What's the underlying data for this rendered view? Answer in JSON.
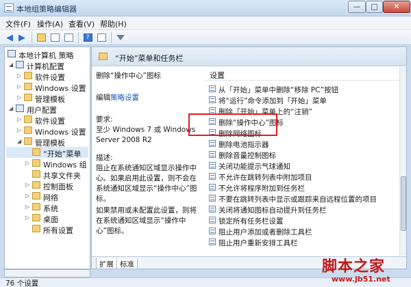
{
  "window": {
    "title": "本地组策略编辑器",
    "min_label": "—",
    "max_label": "□",
    "close_label": "✕"
  },
  "menu": {
    "items": [
      "文件(F)",
      "操作(A)",
      "查看(V)",
      "帮助(H)"
    ]
  },
  "tree": {
    "items": [
      {
        "label": "本地计算机 策略",
        "icon": "computer-icon"
      },
      {
        "label": "计算机配置",
        "icon": "computer-icon"
      },
      {
        "label": "软件设置",
        "icon": "folder-icon"
      },
      {
        "label": "Windows 设置",
        "icon": "folder-icon"
      },
      {
        "label": "管理模板",
        "icon": "folder-icon"
      },
      {
        "label": "用户配置",
        "icon": "user-icon"
      },
      {
        "label": "软件设置",
        "icon": "folder-icon"
      },
      {
        "label": "Windows 设置",
        "icon": "folder-icon"
      },
      {
        "label": "管理模板",
        "icon": "folder-icon"
      },
      {
        "label": "“开始”菜单",
        "icon": "folder-icon"
      },
      {
        "label": "Windows 组",
        "icon": "folder-icon"
      },
      {
        "label": "共享文件夹",
        "icon": "folder-icon"
      },
      {
        "label": "控制面板",
        "icon": "folder-icon"
      },
      {
        "label": "网络",
        "icon": "folder-icon"
      },
      {
        "label": "系统",
        "icon": "folder-icon"
      },
      {
        "label": "桌面",
        "icon": "folder-icon"
      },
      {
        "label": "所有设置",
        "icon": "folder-icon"
      }
    ]
  },
  "details": {
    "header_title": "“开始”菜单和任务栏",
    "policy_title": "删除“操作中心”图标",
    "edit_prefix": "编辑",
    "edit_link": "策略设置",
    "requirements_label": "要求:",
    "requirements_text": "至少 Windows 7 或 Windows Server 2008 R2",
    "description_label": "描述:",
    "description_text": "阻止在系统通知区域显示操作中心。如果启用此设置，则不会在系统通知区域显示“操作中心”图标。",
    "description_text2": "如果禁用或未配置此设置，则将在系统通知区域显示“操作中心”图标。"
  },
  "list": {
    "header": "设置",
    "items": [
      "从「开始」菜单中删除“移除 PC”按钮",
      "将“运行”命令添加到「开始」菜单",
      "删除「开始」菜单上的“注销”",
      "删除“操作中心”图标",
      "删除网络图标",
      "删除电池指示器",
      "删除音量控制图标",
      "关闭功能提示气球通知",
      "不允许在跳转列表中附加项目",
      "不允许将程序附加到任务栏",
      "不要在跳转列表中显示或跟踪来自远程位置的项目",
      "关闭将通知图标自动提升到任务栏",
      "锁定所有任务栏设置",
      "阻止用户添加或者删除工具栏",
      "阻止用户重新安排工具栏"
    ]
  },
  "tabs": [
    "扩展",
    "标准"
  ],
  "status": {
    "text": "76 个设置"
  },
  "watermark": {
    "brand": "脚本之家",
    "url": "www.jb51.net"
  }
}
